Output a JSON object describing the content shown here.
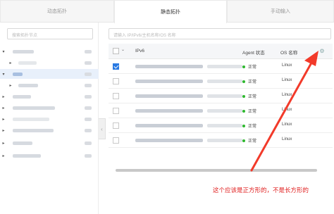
{
  "tabs": [
    {
      "label": "动态拓扑"
    },
    {
      "label": "静态拓扑"
    },
    {
      "label": "手动输入"
    }
  ],
  "sidebar": {
    "search_placeholder": "搜索拓扑节点"
  },
  "main": {
    "search_placeholder": "请输入 IP/IPv6/主机名称/OS 名称",
    "columns": {
      "ipv6": "IPv6",
      "agent": "Agent 状态",
      "os": "OS 名称"
    },
    "rows": [
      {
        "checked": true,
        "status": "正常",
        "os": "Linux"
      },
      {
        "checked": false,
        "status": "正常",
        "os": "Linux"
      },
      {
        "checked": false,
        "status": "正常",
        "os": "Linux"
      },
      {
        "checked": false,
        "status": "正常",
        "os": "Linux"
      },
      {
        "checked": false,
        "status": "正常",
        "os": "Linux"
      },
      {
        "checked": false,
        "status": "正常",
        "os": "Linux"
      }
    ]
  },
  "annotation": {
    "text": "这个应该是正方形的，不是长方形的",
    "color": "#e02020"
  },
  "colors": {
    "accent": "#2a7ae2",
    "status_ok": "#2eb82e"
  }
}
